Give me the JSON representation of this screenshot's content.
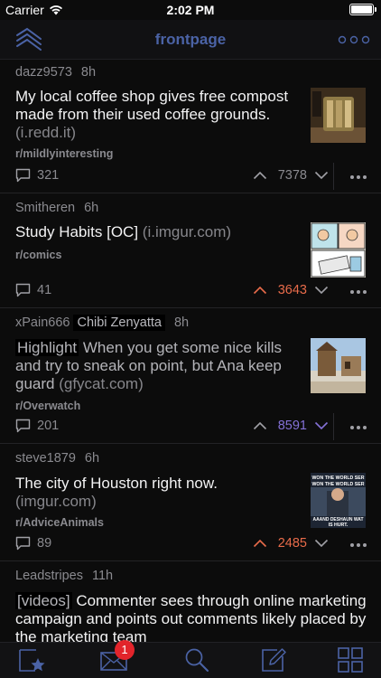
{
  "status_bar": {
    "carrier": "Carrier",
    "time": "2:02 PM"
  },
  "nav": {
    "title": "frontpage",
    "left_icon": "reddit-logo-icon",
    "right_icon": "more-options-icon"
  },
  "colors": {
    "accent": "#4b63a6",
    "upvote": "#e86b4a",
    "downvote": "#8471d6",
    "background": "#0c0c0c"
  },
  "posts": [
    {
      "author": "dazz9573",
      "time": "8h",
      "title": "My local coffee shop gives free compost made from their used coffee grounds.",
      "domain": "(i.redd.it)",
      "subreddit": "r/mildlyinteresting",
      "comments": "321",
      "score": "7378",
      "vote_state": "none"
    },
    {
      "author": "Smitheren",
      "time": "6h",
      "title": "Study Habits [OC]",
      "domain": "(i.imgur.com)",
      "subreddit": "r/comics",
      "comments": "41",
      "score": "3643",
      "vote_state": "up"
    },
    {
      "author": "xPain666",
      "flair": "Chibi Zenyatta",
      "time": "8h",
      "title_flair": "Highlight",
      "title": "When you get some nice kills and try to sneak on point, but Ana keep guard",
      "domain": "(gfycat.com)",
      "subreddit": "r/Overwatch",
      "comments": "201",
      "score": "8591",
      "vote_state": "down"
    },
    {
      "author": "steve1879",
      "time": "6h",
      "title": "The city of Houston right now.",
      "domain": "(imgur.com)",
      "subreddit": "r/AdviceAnimals",
      "comments": "89",
      "score": "2485",
      "vote_state": "up",
      "thumb_text": "WON THE WORLD SER WON THE WORLD SER AAAND DESHAUN WAT IS HURT."
    },
    {
      "author": "Leadstripes",
      "time": "11h",
      "title_flair": "[videos]",
      "title": "Commenter sees through online marketing campaign and points out comments likely placed by the marketing team"
    }
  ],
  "tabbar": {
    "items": [
      "starred-posts-icon",
      "inbox-icon",
      "search-icon",
      "compose-icon",
      "subreddits-icon"
    ],
    "inbox_badge": "1"
  }
}
